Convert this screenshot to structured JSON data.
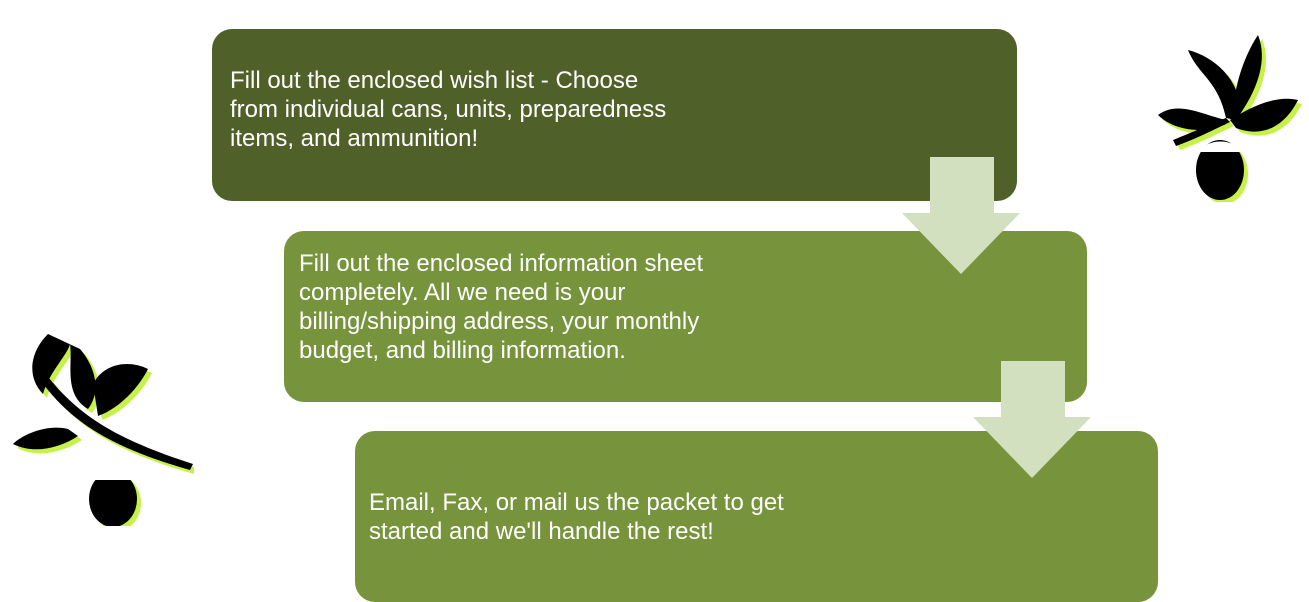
{
  "colors": {
    "step1": "#4f6128",
    "step2": "#77933c",
    "step3": "#77933c",
    "arrow": "#d3e0bf",
    "leaf": "#000000",
    "leaf_shadow": "#c6f04a"
  },
  "steps": [
    {
      "text": "Fill out the enclosed wish list - Choose\nfrom individual cans, units, preparedness\nitems,  and ammunition!"
    },
    {
      "text": "Fill out the enclosed information sheet\ncompletely.  All we need is your\nbilling/shipping address, your monthly\nbudget, and billing information."
    },
    {
      "text": "Email, Fax, or mail us the packet to get\nstarted and we'll handle the rest!"
    }
  ],
  "decorations": {
    "icon": "oak-leaf-acorn-icon"
  }
}
